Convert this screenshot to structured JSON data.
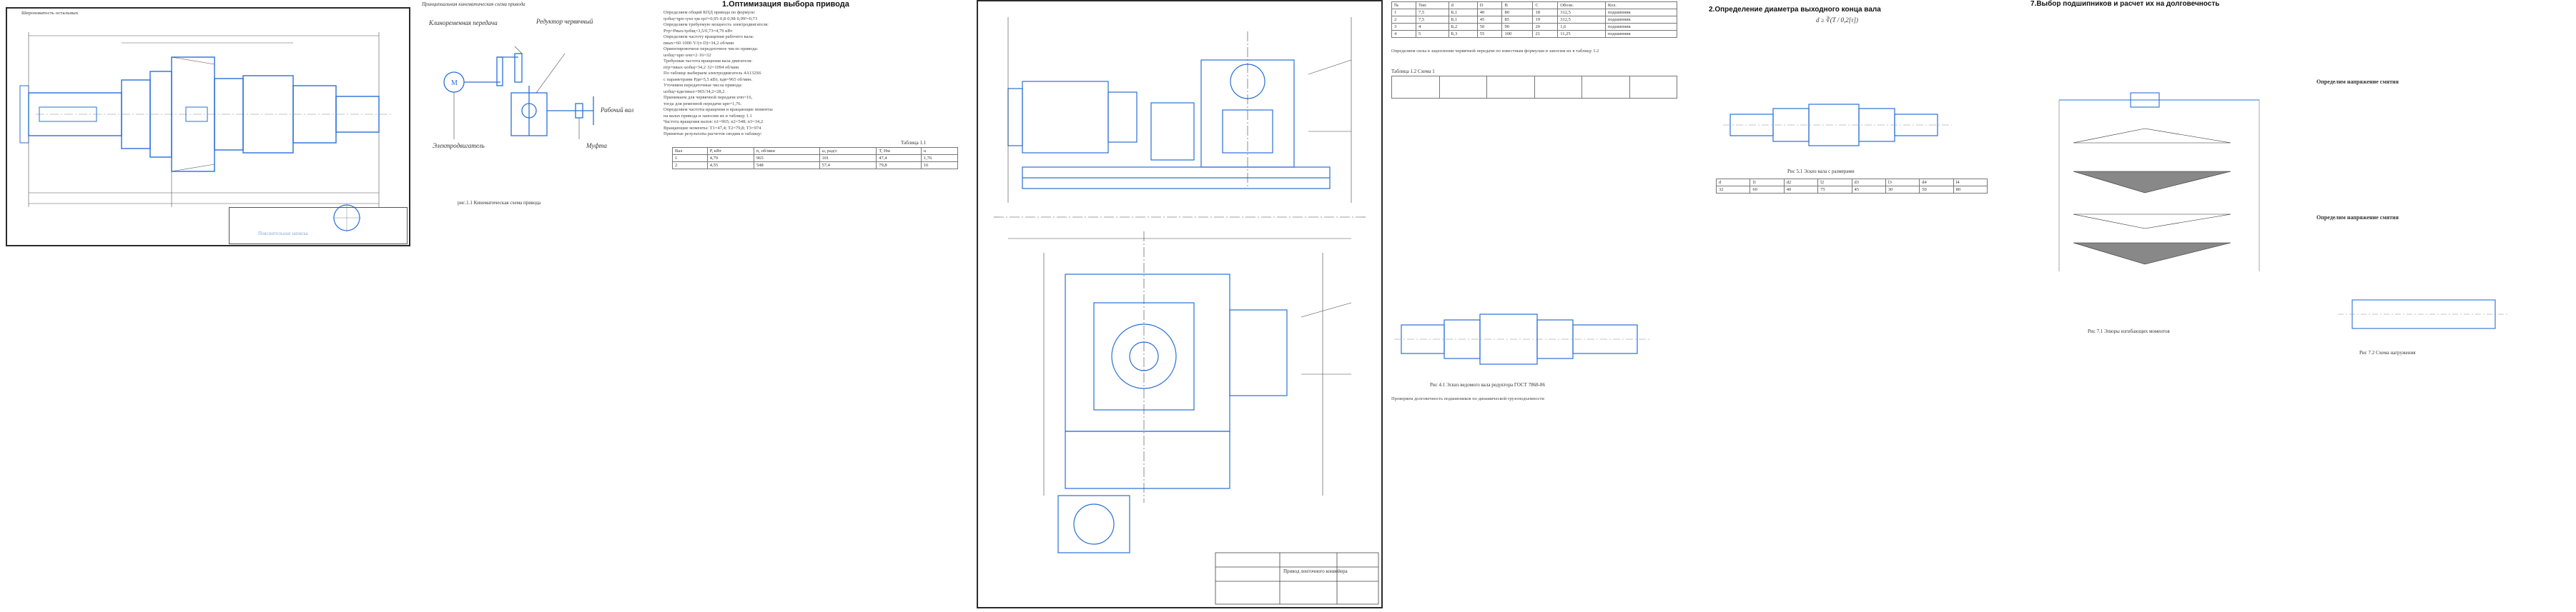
{
  "doc1": {
    "frame_label": "Шероховатость остальных",
    "title_block_text": "Пояснительная записка"
  },
  "doc2": {
    "header_text": "Принципиальная кинематическая схема привода",
    "labels": {
      "chain": "Клиноременная передача",
      "reducer": "Редуктор червячный",
      "motor": "Электродвигатель",
      "shaft": "Рабочий вал",
      "coupling": "Муфта"
    },
    "caption": "рис.1.1 Кинематическая схема привода"
  },
  "doc3": {
    "heading": "1.Оптимизация выбора привода",
    "lines": [
      "Определяем общий КПД привода по формуле:",
      "ηобщ=ηрп·ηчп·ηм·ηп²=0,95·0,8·0,98·0,99²=0,73",
      "Определяем требуемую мощность электродвигателя:",
      "Pтр=Pвых/ηобщ=3,5/0,73=4,79 кВт",
      "Определяем частоту вращения рабочего вала:",
      "nвых=60·1000·V/(π·D)=34,2 об/мин",
      "Ориентировочное передаточное число привода:",
      "uобщ=uрп·uчп=2·16=32",
      "Требуемая частота вращения вала двигателя:",
      "nтр=nвых·uобщ=34,2·32=1094 об/мин",
      "По таблице выбираем электродвигатель 4А132S6",
      "с параметрами Рдв=5,5 кВт, nдв=965 об/мин.",
      "Уточняем передаточные числа привода:",
      "uобщ=nдв/nвых=965/34,2=28,2",
      "Принимаем для червячной передачи uчп=16,",
      "тогда для ременной передачи uрп=1,76.",
      "Определяем частоты вращения и вращающие моменты",
      "на валах привода и заносим их в таблицу 1.1",
      "Частота вращения валов: n1=965; n2=548; n3=34,2",
      "Вращающие моменты: T1=47,4; T2=79,8; T3=974",
      "Принятые результаты расчетов сводим в таблицу:"
    ],
    "table_caption": "Таблица 1.1",
    "table": [
      [
        "Вал",
        "P, кВт",
        "n, об/мин",
        "ω, рад/с",
        "T, Нм",
        "u"
      ],
      [
        "1",
        "4,79",
        "965",
        "101",
        "47,4",
        "1,76"
      ],
      [
        "2",
        "4,55",
        "548",
        "57,4",
        "79,8",
        "16"
      ]
    ]
  },
  "doc4": {
    "drawing_label": "Привод ленточного конвейера"
  },
  "doc5": {
    "table_header": [
      "№",
      "Тип",
      "d",
      "D",
      "B",
      "C",
      "Обозн.",
      "Кол."
    ],
    "table_rows": [
      [
        "1",
        "7,5",
        "Б,1",
        "40",
        "80",
        "18",
        "312,5",
        "подшипник"
      ],
      [
        "2",
        "7,5",
        "Б,1",
        "45",
        "85",
        "19",
        "312,5",
        "подшипник"
      ],
      [
        "3",
        "4",
        "Б,2",
        "50",
        "90",
        "20",
        "1,6",
        "подшипник"
      ],
      [
        "4",
        "5",
        "Б,3",
        "55",
        "100",
        "21",
        "11,25",
        "подшипник"
      ]
    ],
    "para1": "Определяем силы в зацеплении червячной передачи по известным формулам и заносим их в таблицу 1.2",
    "table2_caption": "Таблица 1.2 Схема 1",
    "caption": "Рис 4.1 Эскиз ведомого вала редуктора ГОСТ 7868-86",
    "para2": "Проверяем долговечность подшипников по динамической грузоподъемности"
  },
  "doc6": {
    "heading": "2.Определение диаметра выходного конца вала",
    "formula": "d ≥ ∛(T / 0,2[τ])",
    "caption": "Рис 5.1 Эскиз вала с размерами",
    "table_header": [
      "d",
      "l1",
      "d2",
      "l2",
      "d3",
      "l3",
      "d4",
      "l4"
    ],
    "table_values": [
      "32",
      "60",
      "40",
      "75",
      "45",
      "30",
      "50",
      "80"
    ]
  },
  "doc7": {
    "heading": "7.Выбор подшипников и расчет их на долговечность",
    "caption": "Рис 7.1 Эпюры изгибающих моментов",
    "caption2": "Рис 7.2 Схема нагружения",
    "section_a": "Определим напряжение смятия",
    "section_b": "Определим напряжение смятия"
  }
}
